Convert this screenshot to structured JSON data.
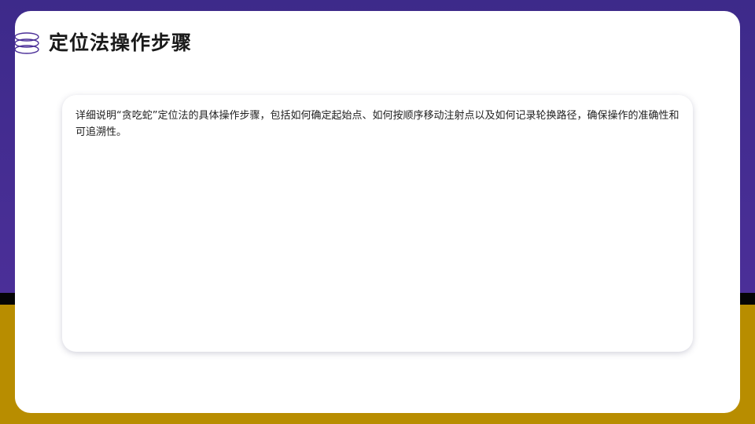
{
  "slide": {
    "title": "定位法操作步骤",
    "body": "详细说明“贪吃蛇”定位法的具体操作步骤，包括如何确定起始点、如何按顺序移动注射点以及如何记录轮换路径，确保操作的准确性和可追溯性。"
  },
  "colors": {
    "top_band": "#4b2f98",
    "stripe": "#050505",
    "bottom_band": "#b88d00",
    "card": "#ffffff",
    "logo_stroke": "#4b2f98"
  },
  "icons": {
    "logo": "ring-stack-icon"
  }
}
